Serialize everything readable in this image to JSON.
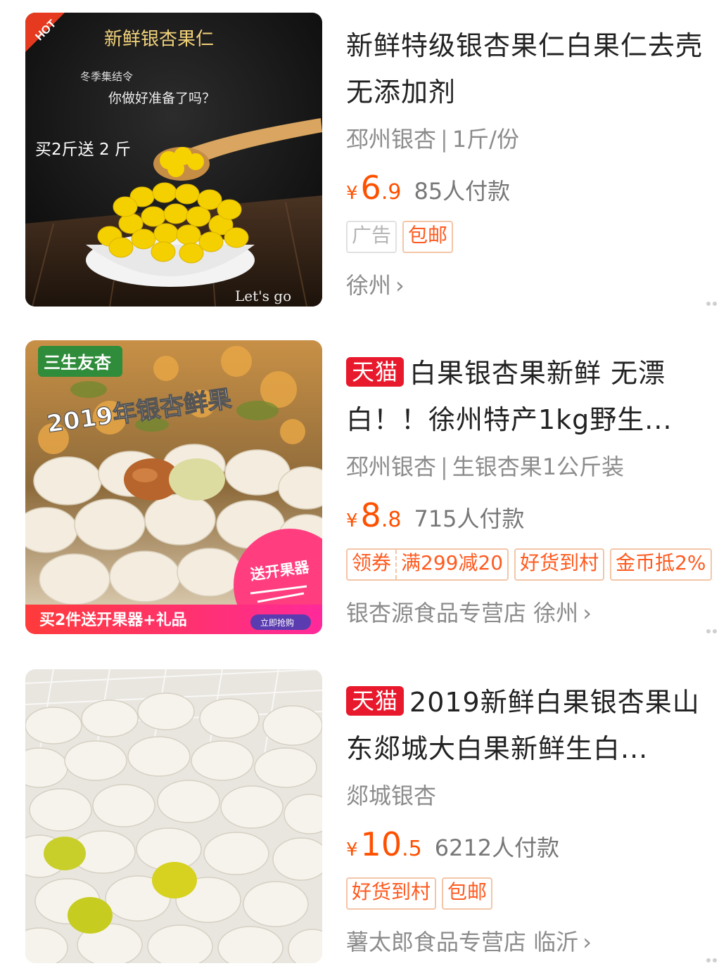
{
  "products": [
    {
      "tmall_badge": "",
      "title": "新鲜特级银杏果仁白果仁去壳无添加剂",
      "sub_left": "邳州银杏",
      "sub_sep": "|",
      "sub_right": "1斤/份",
      "currency": "¥",
      "price_int": "6",
      "price_dec": ".9",
      "buyers": "85人付款",
      "tags": [
        "广告",
        "包邮"
      ],
      "shop": "徐州",
      "image": {
        "hot": "HOT",
        "headline": "新鲜银杏果仁",
        "line1": "冬季集结令",
        "line2": "你做好准备了吗？",
        "promo": "买2斤送 2 斤",
        "footer": "Let's go"
      }
    },
    {
      "tmall_badge": "天猫",
      "title": "白果银杏果新鲜 无漂白！！徐州特产1kg野生...",
      "sub_left": "邳州银杏",
      "sub_sep": "|",
      "sub_right": "生银杏果1公斤装",
      "currency": "¥",
      "price_int": "8",
      "price_dec": ".8",
      "buyers": "715人付款",
      "tags": [
        "领券",
        "满299减20",
        "好货到村",
        "金币抵2%"
      ],
      "shop": "银杏源食品专营店 徐州",
      "image": {
        "brand": "三生友杏",
        "headline": "2019年银杏鲜果",
        "gift": "送开果器",
        "banner": "买2件送开果器+礼品",
        "cta": "立即抢购"
      }
    },
    {
      "tmall_badge": "天猫",
      "title": "2019新鲜白果银杏果山东郯城大白果新鲜生白...",
      "sub_left": "郯城银杏",
      "currency": "¥",
      "price_int": "10",
      "price_dec": ".5",
      "buyers": "6212人付款",
      "tags": [
        "好货到村",
        "包邮"
      ],
      "shop": "薯太郎食品专营店 临沂"
    }
  ],
  "colors": {
    "price": "#ff5000",
    "tmall": "#e8192c",
    "tag_border": "#f3c6a8"
  }
}
